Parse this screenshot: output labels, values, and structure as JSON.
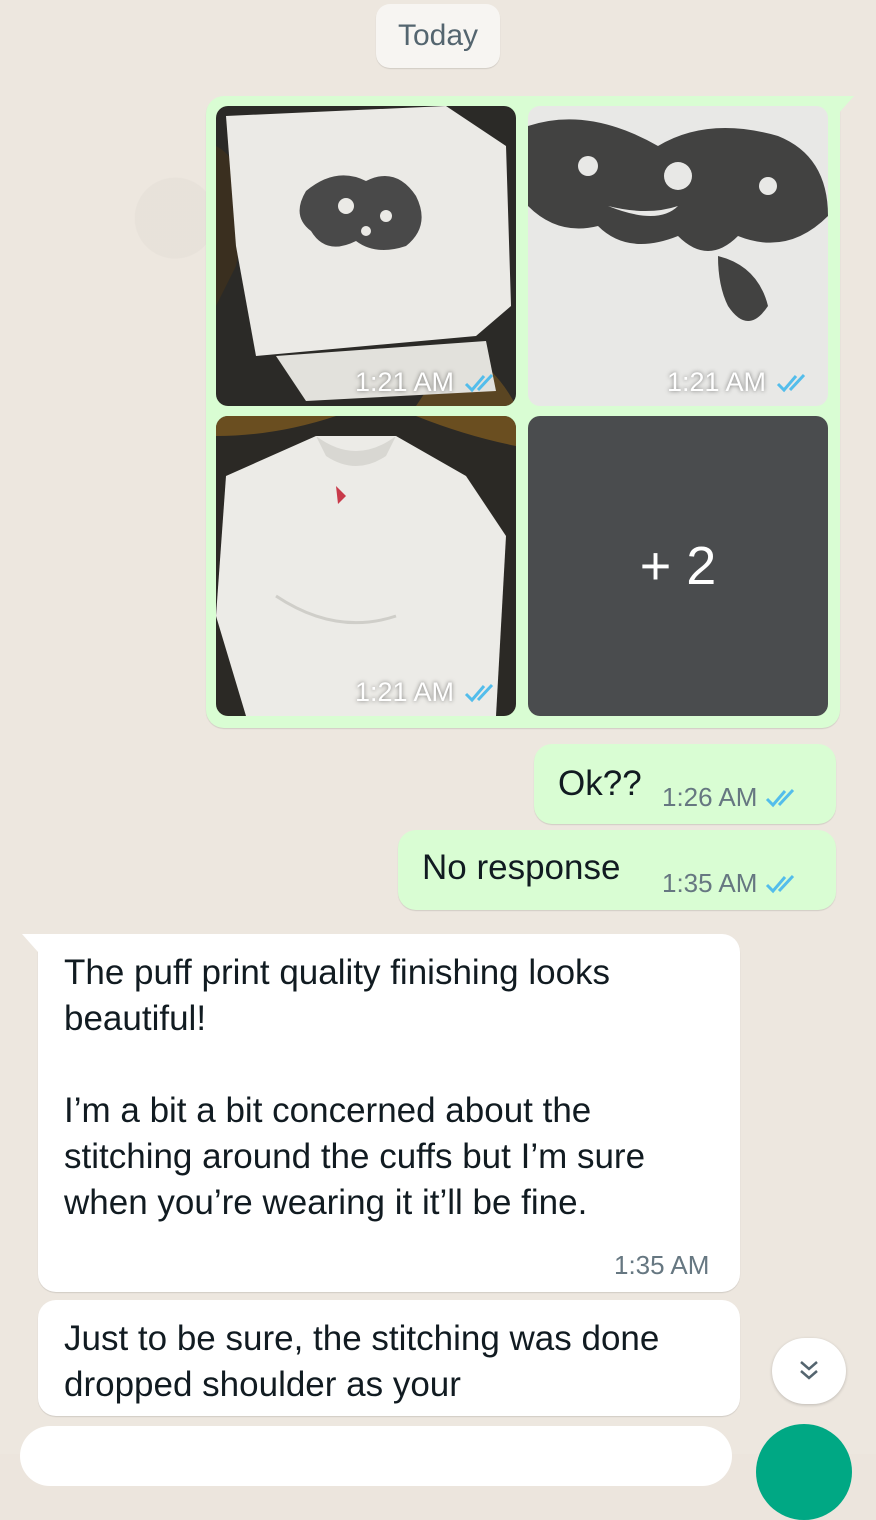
{
  "date_label": "Today",
  "media_group": {
    "tiles": [
      {
        "time": "1:21 AM"
      },
      {
        "time": "1:21 AM"
      },
      {
        "time": "1:21 AM"
      }
    ],
    "more_label": "+ 2"
  },
  "outgoing": [
    {
      "text": "Ok??",
      "time": "1:26 AM"
    },
    {
      "text": "No response",
      "time": "1:35 AM"
    }
  ],
  "incoming": [
    {
      "para1": "The puff print quality finishing looks beautiful!",
      "para2": "I’m a bit a bit concerned about the stitching around the cuffs but I’m sure when you’re wearing it it’ll be fine.",
      "time": "1:35 AM"
    },
    {
      "para1": "Just to be sure, the stitching was done dropped shoulder as your"
    }
  ],
  "colors": {
    "outgoing_bubble": "#d9fdd3",
    "incoming_bubble": "#ffffff",
    "read_tick": "#53bdeb",
    "send_button": "#00a884"
  },
  "icons": [
    "double-check-icon",
    "chevrons-down-icon",
    "mic-icon"
  ]
}
